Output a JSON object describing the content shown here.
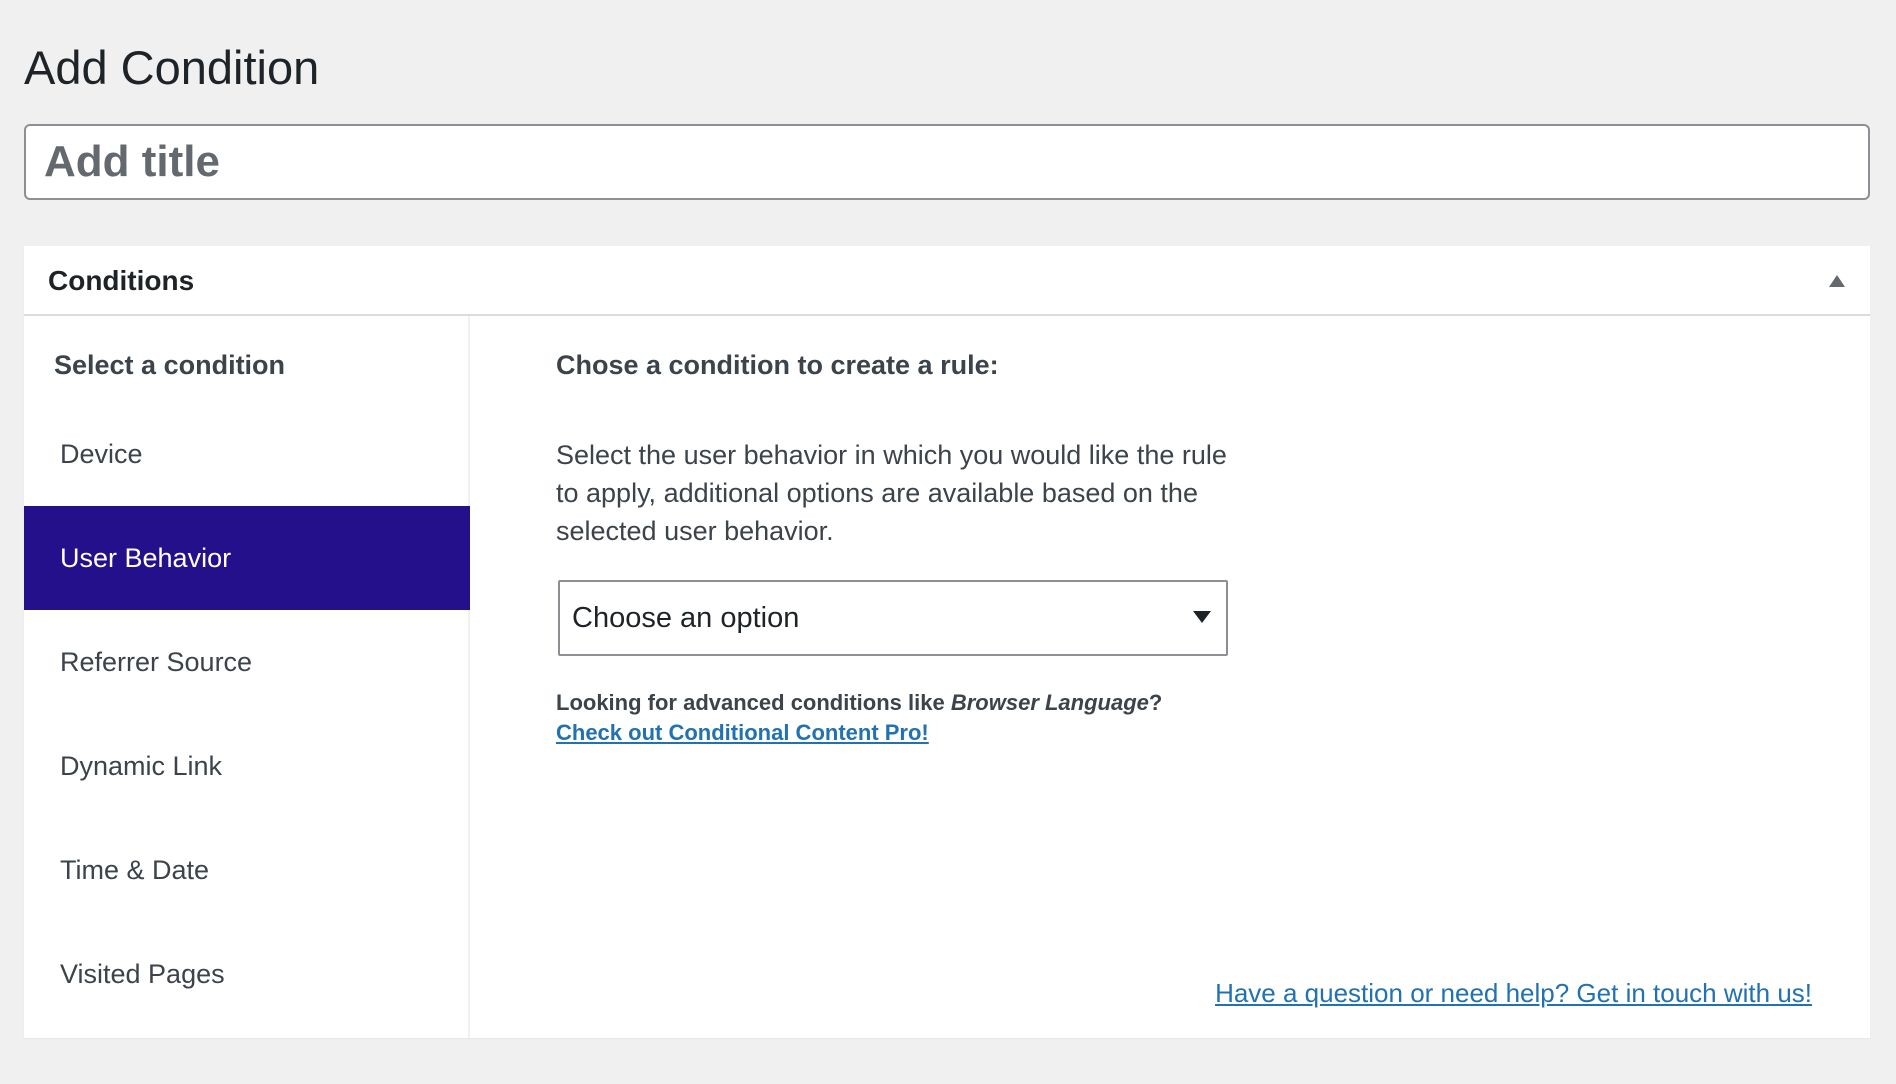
{
  "page": {
    "title": "Add Condition"
  },
  "title_field": {
    "placeholder": "Add title",
    "value": ""
  },
  "conditions_panel": {
    "title": "Conditions",
    "collapse_icon": "triangle-up-icon",
    "sidebar": {
      "heading": "Select a condition",
      "active_index": 1,
      "active_color": "#23108a",
      "items": [
        {
          "label": "Device"
        },
        {
          "label": "User Behavior"
        },
        {
          "label": "Referrer Source"
        },
        {
          "label": "Dynamic Link"
        },
        {
          "label": "Time & Date"
        },
        {
          "label": "Visited Pages"
        }
      ]
    },
    "content": {
      "heading": "Chose a condition to create a rule:",
      "description": "Select the user behavior in which you would like the rule to apply, additional options are available based on the selected user behavior.",
      "select": {
        "value": "Choose an option",
        "arrow_icon": "caret-down-icon"
      },
      "upsell": {
        "prefix": "Looking for advanced conditions like ",
        "emphasis": "Browser Language",
        "suffix": "?",
        "link_label": "Check out Conditional Content Pro!"
      },
      "help_link": "Have a question or need help? Get in touch with us!"
    }
  },
  "colors": {
    "background": "#f0f0f1",
    "link": "#2271b1",
    "active_item": "#23108a"
  }
}
